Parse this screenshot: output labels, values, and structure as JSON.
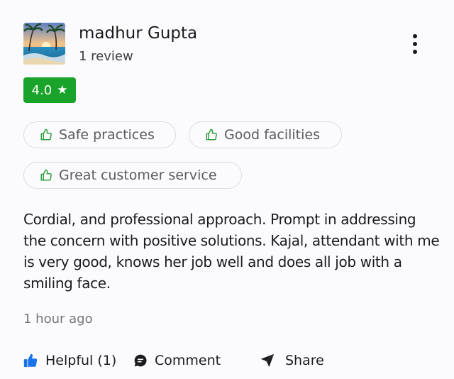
{
  "review": {
    "reviewer_name": "madhur Gupta",
    "review_count": "1 review",
    "rating": "4.0",
    "rating_star": "★",
    "tags": [
      {
        "label": "Safe practices",
        "icon": "thumbs-up-outline-icon"
      },
      {
        "label": "Good facilities",
        "icon": "thumbs-up-outline-icon"
      },
      {
        "label": "Great customer service",
        "icon": "thumbs-up-outline-icon"
      }
    ],
    "text": "Cordial, and professional approach. Prompt in addressing the concern with positive solutions. Kajal, attendant with me is very good, knows her job well and does all job with a smiling face.",
    "timestamp": "1 hour ago"
  },
  "actions": {
    "helpful_label": "Helpful (1)",
    "comment_label": "Comment",
    "share_label": "Share"
  },
  "colors": {
    "rating_badge": "#1aa32a",
    "thumb_icon": "#2f9e3e",
    "helpful_icon": "#1a73e8",
    "text_primary": "#1b1b1f",
    "text_secondary": "#74747a"
  },
  "icons": {
    "avatar": "beach-palm-avatar",
    "more": "more-vertical-icon",
    "helpful": "thumbs-up-filled-icon",
    "comment": "comment-bubble-icon",
    "share": "send-icon"
  }
}
